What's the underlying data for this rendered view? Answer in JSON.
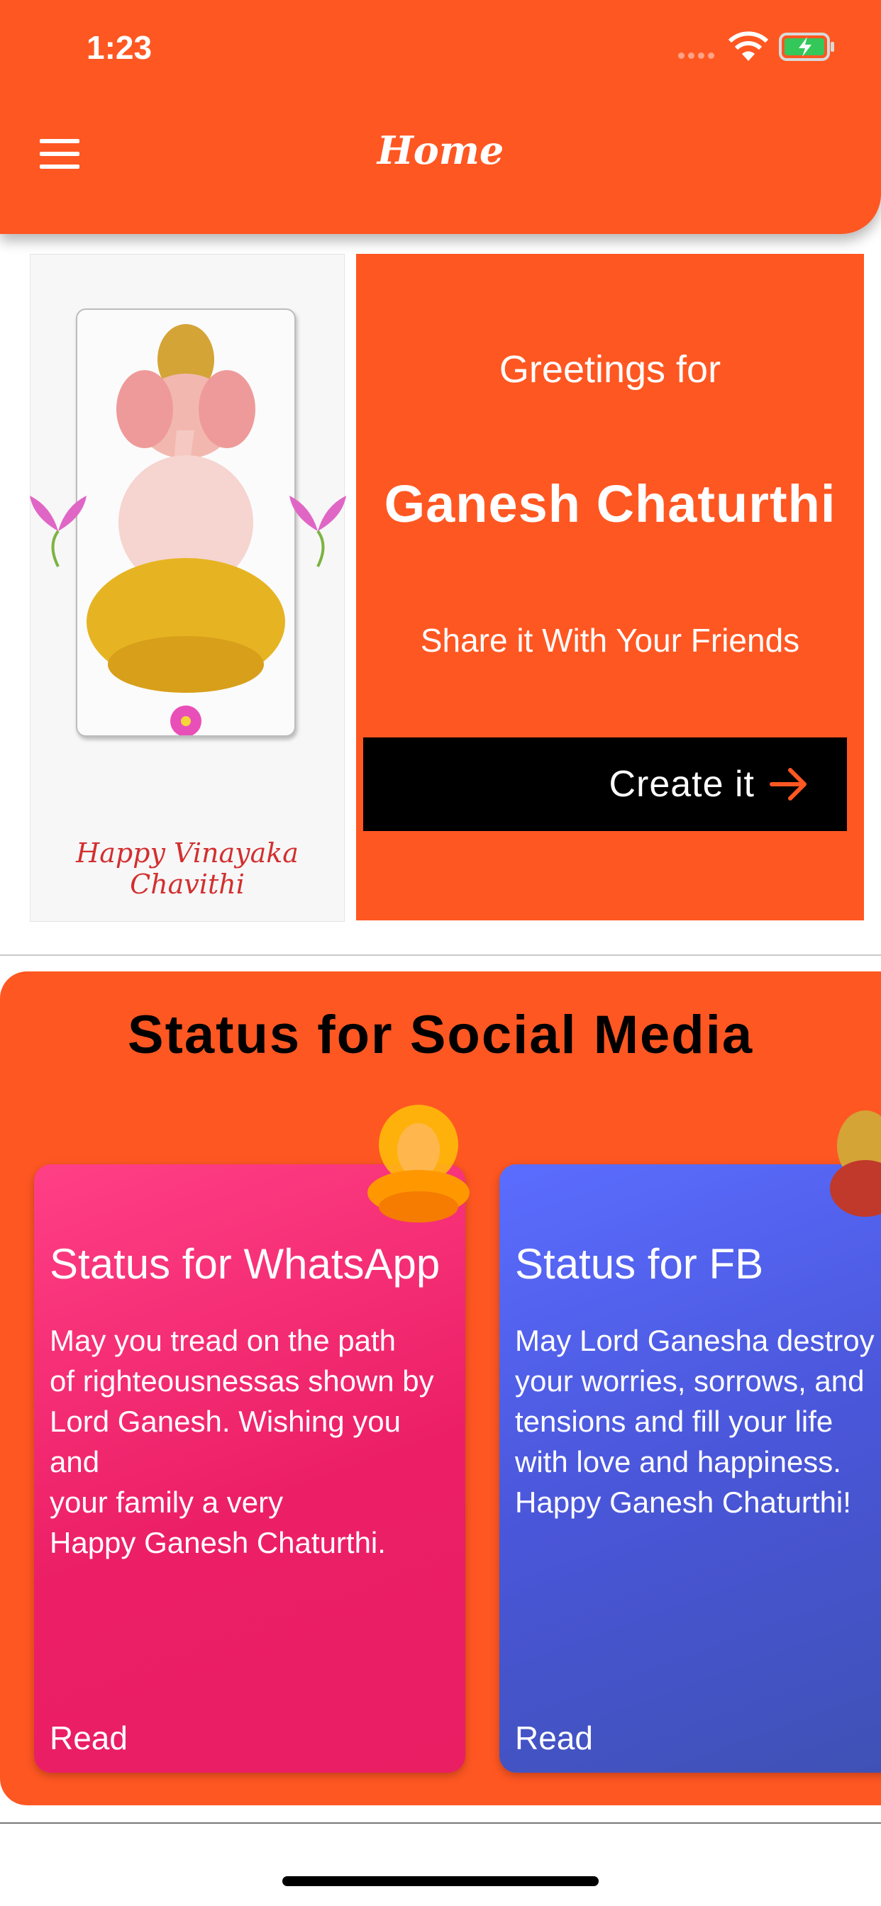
{
  "status_bar": {
    "time": "1:23"
  },
  "header": {
    "title": "Home"
  },
  "greeting": {
    "line1": "Greetings for",
    "line2": "Ganesh Chaturthi",
    "line3": "Share it With Your Friends",
    "button_label": "Create it",
    "image_caption": "Happy Vinayaka Chavithi"
  },
  "social": {
    "title": "Status for Social Media",
    "cards": [
      {
        "title": "Status for WhatsApp",
        "body": "May you tread on the path\nof righteousnessas shown by\nLord Ganesh. Wishing you and\nyour family a very\nHappy Ganesh Chaturthi.",
        "read_label": "Read"
      },
      {
        "title": "Status for FB",
        "body": "May Lord Ganesha destroy\nyour worries, sorrows, and\ntensions and fill your life\nwith love and happiness.\nHappy Ganesh Chaturthi!",
        "read_label": "Read"
      }
    ]
  },
  "colors": {
    "accent": "#FF5722",
    "whatsapp_card": "#E91E63",
    "fb_card": "#3F51B5"
  }
}
